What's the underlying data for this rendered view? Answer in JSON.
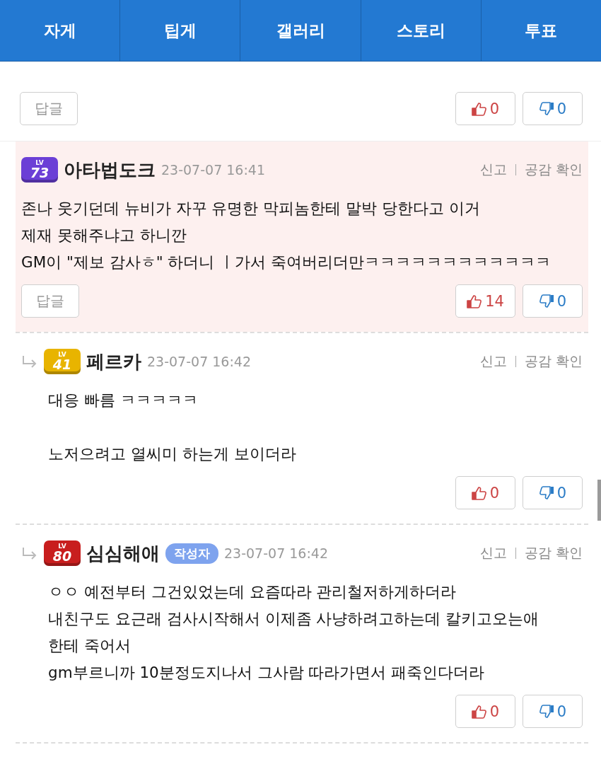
{
  "nav_tabs": [
    {
      "label": "자게"
    },
    {
      "label": "팁게"
    },
    {
      "label": "갤러리"
    },
    {
      "label": "스토리"
    },
    {
      "label": "투표"
    }
  ],
  "top_actions": {
    "reply_button": "답글",
    "likes": "0",
    "dislikes": "0"
  },
  "comments": [
    {
      "kind": "comment",
      "highlighted": true,
      "badge": {
        "prefix": "LV",
        "level": "73",
        "color": "#6b3fd6"
      },
      "author": "아타법도크",
      "date": "23-07-07 16:41",
      "report": "신고",
      "empathy": "공감 확인",
      "paragraphs": [
        [
          "존나 웃기던데 뉴비가 자꾸 유명한 막피놈한테 말박 당한다고 이거",
          "제재 못해주냐고 하니깐",
          "GM이 \"제보 감사ㅎ\" 하더니 ㅣ가서 죽여버리더만ㅋㅋㅋㅋㅋㅋㅋㅋㅋㅋㅋㅋ"
        ]
      ],
      "reply_button": "답글",
      "likes": "14",
      "dislikes": "0"
    },
    {
      "kind": "reply",
      "highlighted": false,
      "badge": {
        "prefix": "LV",
        "level": "41",
        "color": "#e8b400"
      },
      "author": "페르카",
      "date": "23-07-07 16:42",
      "report": "신고",
      "empathy": "공감 확인",
      "paragraphs": [
        [
          "대응 빠름 ㅋㅋㅋㅋㅋ"
        ],
        [
          "노저으려고 열씨미 하는게 보이더라"
        ]
      ],
      "likes": "0",
      "dislikes": "0"
    },
    {
      "kind": "reply",
      "highlighted": false,
      "badge": {
        "prefix": "LV",
        "level": "80",
        "color": "#c81e1e"
      },
      "author": "심심해애",
      "author_tag": "작성자",
      "date": "23-07-07 16:42",
      "report": "신고",
      "empathy": "공감 확인",
      "paragraphs": [
        [
          "ㅇㅇ 예전부터 그건있었는데 요즘따라 관리철저하게하더라",
          "내친구도 요근래 검사시작해서 이제좀 사냥하려고하는데 칼키고오는애",
          "한테 죽어서",
          "gm부르니까 10분정도지나서 그사람 따라가면서 패죽인다더라"
        ]
      ],
      "likes": "0",
      "dislikes": "0"
    }
  ]
}
